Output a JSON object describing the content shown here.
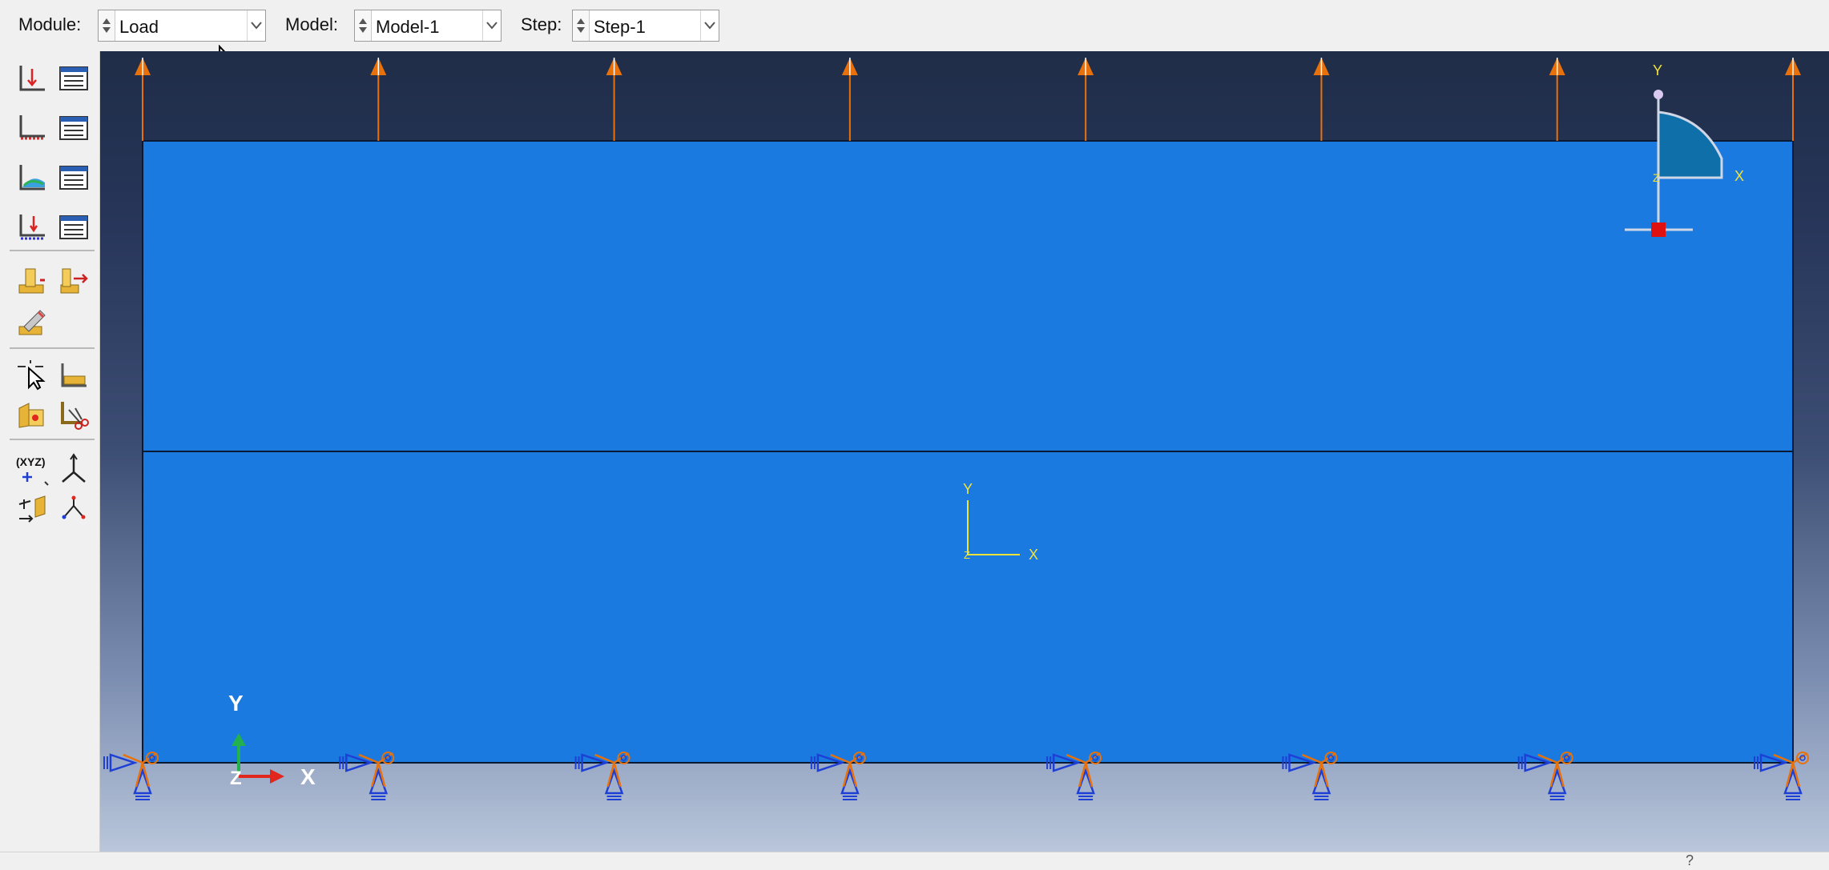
{
  "context_bar": {
    "module": {
      "label": "Module:",
      "value": "Load"
    },
    "model": {
      "label": "Model:",
      "value": "Model-1"
    },
    "step": {
      "label": "Step:",
      "value": "Step-1"
    }
  },
  "toolbox": {
    "tools": [
      {
        "name": "create-load-icon"
      },
      {
        "name": "load-manager-icon"
      },
      {
        "name": "create-bc-icon"
      },
      {
        "name": "bc-manager-icon"
      },
      {
        "name": "create-predefined-field-icon"
      },
      {
        "name": "predefined-field-manager-icon"
      },
      {
        "name": "create-load-case-icon"
      },
      {
        "name": "load-case-manager-icon"
      },
      {
        "name": "create-special-icon"
      },
      {
        "name": "special-move-icon"
      },
      {
        "name": "edit-special-icon"
      },
      {
        "name": "query-select-icon"
      },
      {
        "name": "partition-icon"
      },
      {
        "name": "set-assign-icon"
      },
      {
        "name": "surface-cut-icon"
      },
      {
        "name": "create-datum-point-icon"
      },
      {
        "name": "create-datum-axis-icon"
      },
      {
        "name": "create-datum-plane-icon"
      },
      {
        "name": "create-datum-csys-icon"
      }
    ],
    "datum_point_text": "(XYZ)"
  },
  "viewport": {
    "colors": {
      "part": "#1a7ae0",
      "load_arrow": "#e8710c",
      "bc_symbol": "#1d3fd6",
      "datum_csys": "#f2e33a",
      "triad_x": "#e0261d",
      "triad_y": "#22b14c"
    },
    "local_csys": {
      "y": "Y",
      "x": "X",
      "z": "Z"
    },
    "view_triad": {
      "y": "Y",
      "x": "X",
      "z": "Z"
    },
    "orientation_glyph": {
      "y": "Y",
      "x": "X",
      "z": "Z"
    },
    "load_arrow_count": 8,
    "bc_symbol_count": 8
  },
  "status": {
    "fragment": "?"
  }
}
